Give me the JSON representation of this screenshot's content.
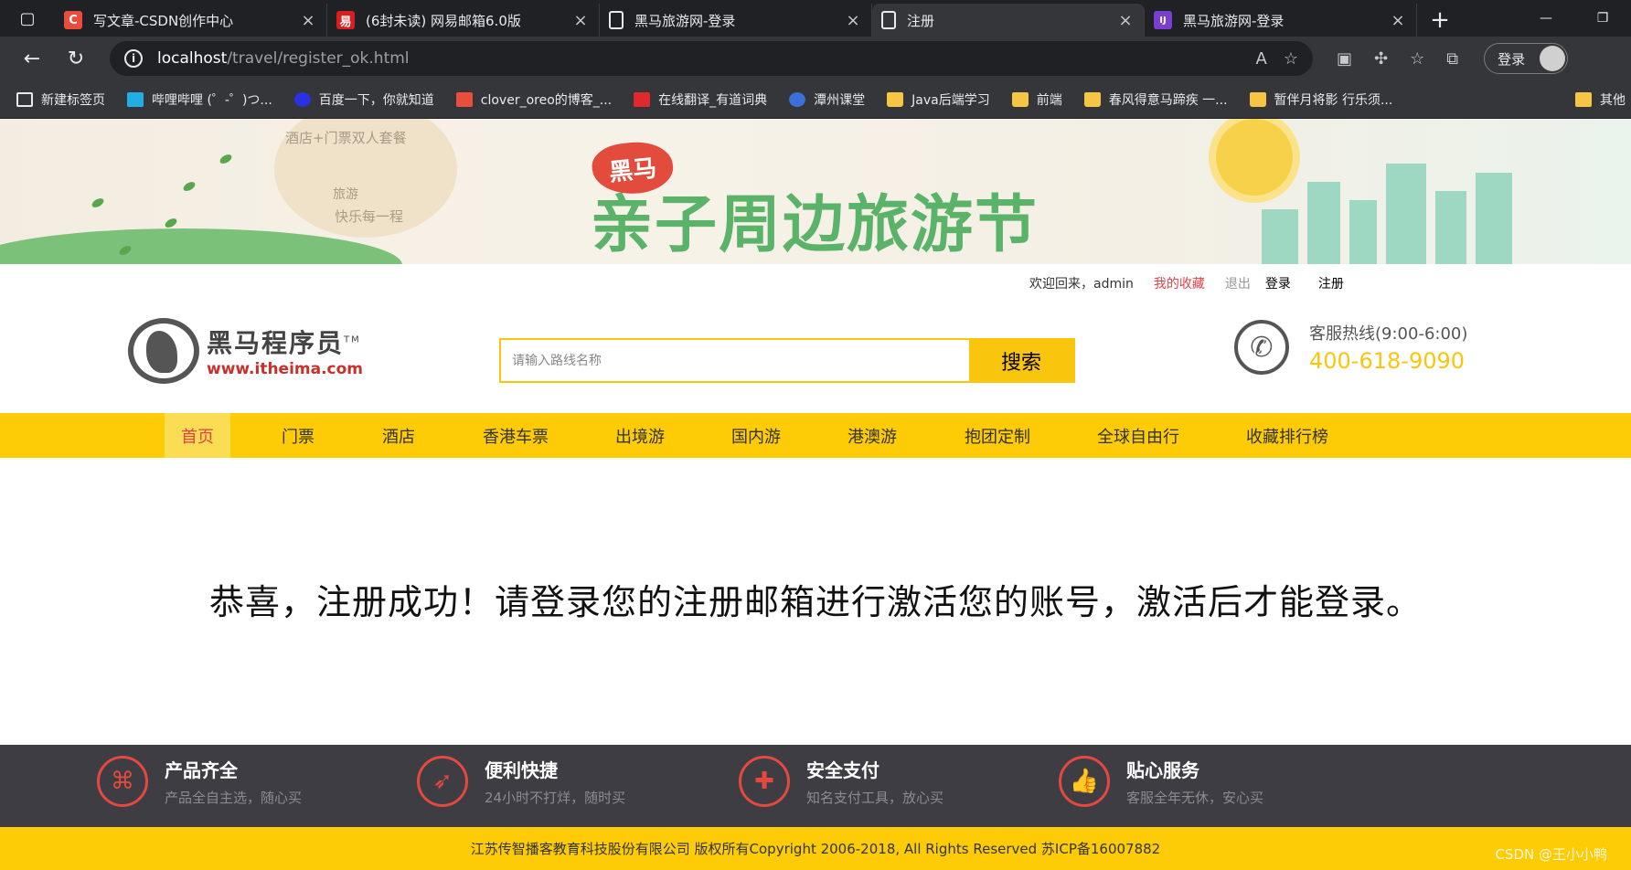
{
  "browser": {
    "tabs": [
      {
        "title": "写文章-CSDN创作中心",
        "icon": "csdn-icon",
        "icon_color": "#e94d3b",
        "icon_char": "C",
        "active": false
      },
      {
        "title": "(6封未读) 网易邮箱6.0版",
        "icon": "netease-mail-icon",
        "icon_color": "#d71f20",
        "icon_char": "易",
        "active": false
      },
      {
        "title": "黑马旅游网-登录",
        "icon": "page-icon",
        "icon_color": "transparent",
        "icon_char": "",
        "active": false
      },
      {
        "title": "注册",
        "icon": "page-icon",
        "icon_color": "transparent",
        "icon_char": "",
        "active": true
      },
      {
        "title": "黑马旅游网-登录",
        "icon": "intellij-icon",
        "icon_color": "#7a3fd1",
        "icon_char": "IJ",
        "active": false
      }
    ],
    "url": {
      "host": "localhost",
      "path": "/travel/register_ok.html"
    },
    "profile_label": "登录",
    "bookmarks": [
      {
        "label": "新建标签页",
        "icon": "newtab-icon",
        "type": "page"
      },
      {
        "label": "哔哩哔哩 (゜-゜)つ...",
        "icon": "bilibili-icon",
        "type": "site"
      },
      {
        "label": "百度一下，你就知道",
        "icon": "baidu-icon",
        "type": "site"
      },
      {
        "label": "clover_oreo的博客_...",
        "icon": "csdn-icon",
        "type": "site"
      },
      {
        "label": "在线翻译_有道词典",
        "icon": "youdao-icon",
        "type": "site"
      },
      {
        "label": "潭州课堂",
        "icon": "tanzhou-icon",
        "type": "site"
      },
      {
        "label": "Java后端学习",
        "icon": "folder-icon",
        "type": "folder"
      },
      {
        "label": "前端",
        "icon": "folder-icon",
        "type": "folder"
      },
      {
        "label": "春风得意马蹄疾 一...",
        "icon": "folder-icon",
        "type": "folder"
      },
      {
        "label": "暂伴月将影 行乐须...",
        "icon": "folder-icon",
        "type": "folder"
      }
    ],
    "other_bookmarks": "其他"
  },
  "banner": {
    "cloud_line1": "酒店+门票双人套餐",
    "cloud_line2": "旅游",
    "cloud_line3": "快乐每一程",
    "badge": "黑马",
    "headline": "亲子周边旅游节"
  },
  "topbar": {
    "welcome": "欢迎回来，admin",
    "favorites": "我的收藏",
    "logout": "退出",
    "login": "登录",
    "register": "注册"
  },
  "logo": {
    "cn": "黑马程序员",
    "en": "www.itheima.com",
    "tm": "TM"
  },
  "search": {
    "placeholder": "请输入路线名称",
    "button": "搜索"
  },
  "hotline": {
    "label": "客服热线(9:00-6:00)",
    "number": "400-618-9090"
  },
  "nav": [
    "首页",
    "门票",
    "酒店",
    "香港车票",
    "出境游",
    "国内游",
    "港澳游",
    "抱团定制",
    "全球自由行",
    "收藏排行榜"
  ],
  "message": "恭喜，注册成功！请登录您的注册邮箱进行激活您的账号，激活后才能登录。",
  "features": [
    {
      "title": "产品齐全",
      "desc": "产品全自主选，随心买",
      "icon": "grid-icon"
    },
    {
      "title": "便利快捷",
      "desc": "24小时不打烊，随时买",
      "icon": "rocket-icon"
    },
    {
      "title": "安全支付",
      "desc": "知名支付工具，放心买",
      "icon": "shield-icon"
    },
    {
      "title": "贴心服务",
      "desc": "客服全年无休，安心买",
      "icon": "thumbs-up-icon"
    }
  ],
  "copyright": "江苏传智播客教育科技股份有限公司 版权所有Copyright 2006-2018, All Rights Reserved 苏ICP备16007882",
  "watermark": "CSDN @王小小鸭",
  "colors": {
    "brand_yellow": "#fecb07",
    "accent_red": "#e3414a",
    "footer_dark": "#3e3d43"
  }
}
